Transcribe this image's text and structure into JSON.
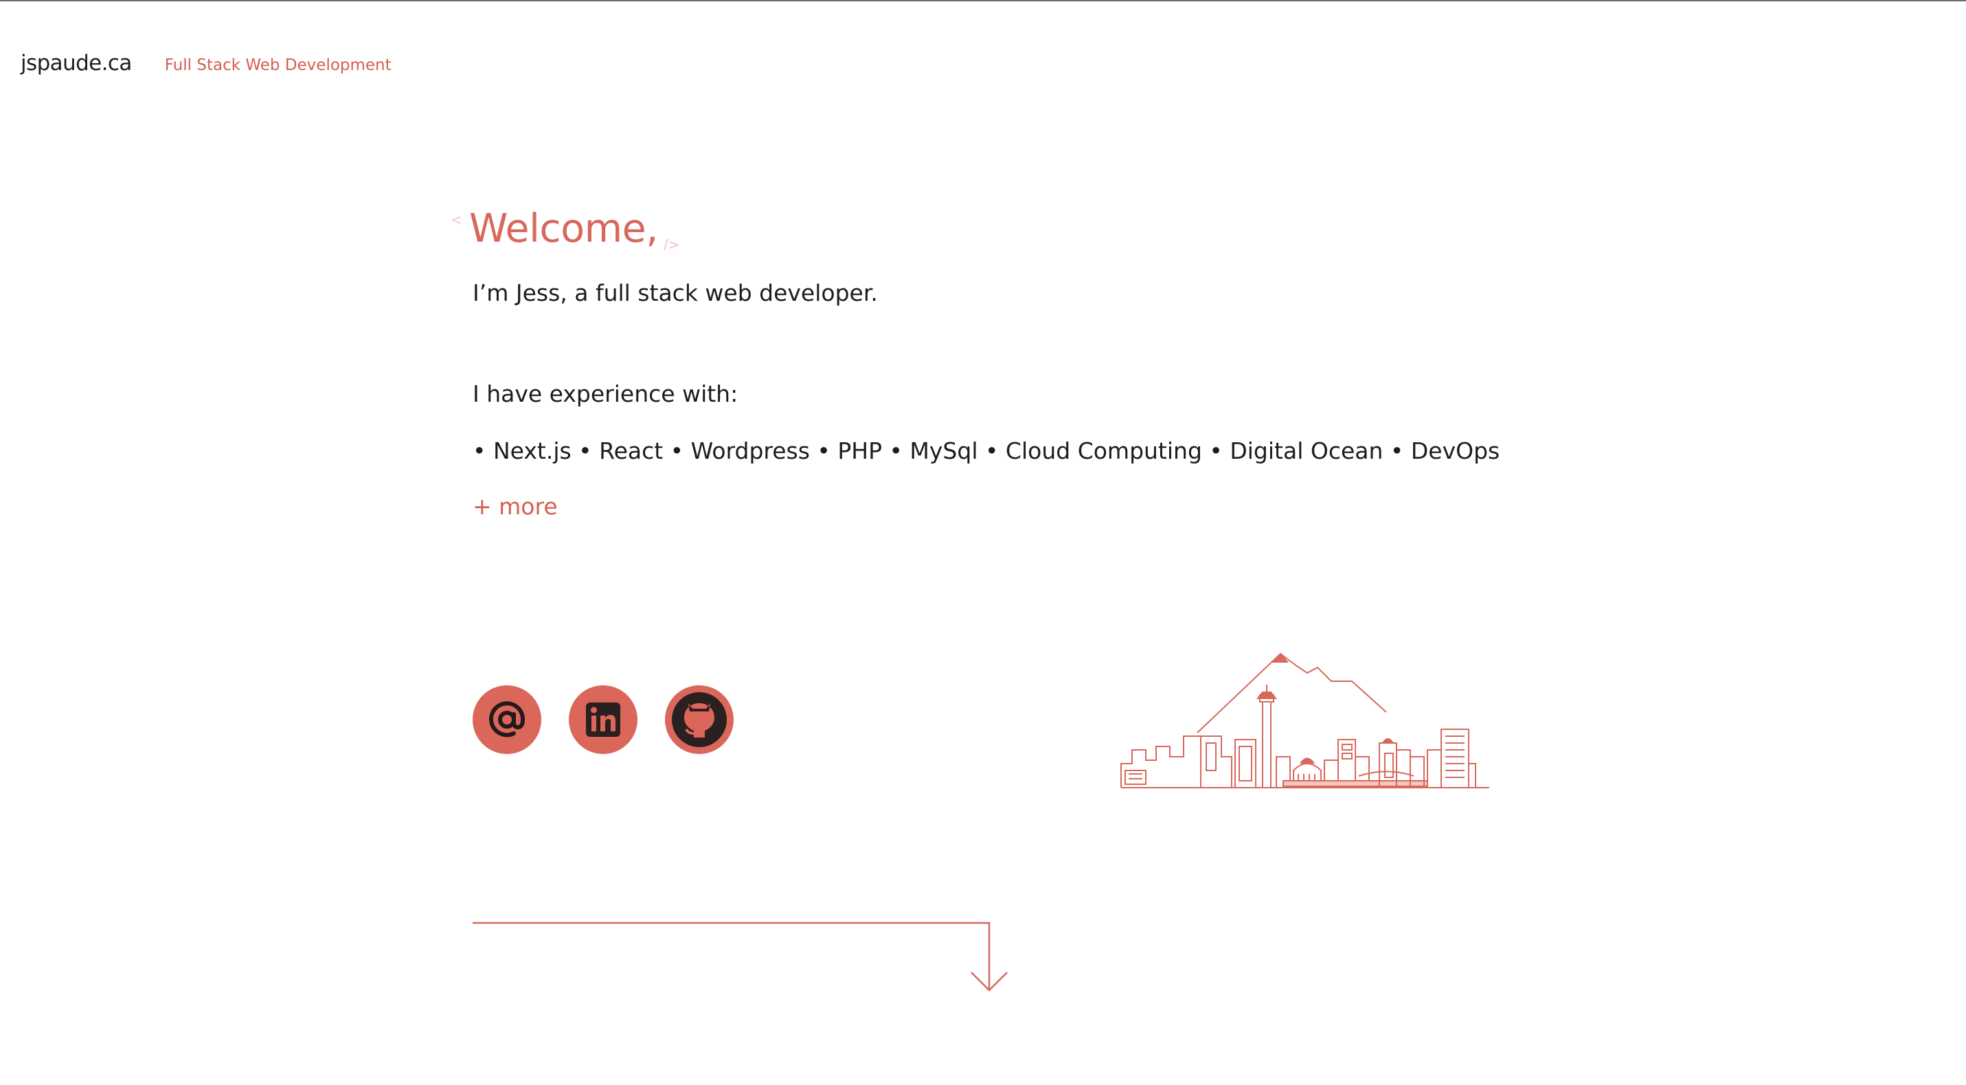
{
  "header": {
    "logo": "jspaude.ca",
    "tagline": "Full Stack Web Development"
  },
  "hero": {
    "tag_open": "<",
    "title": "Welcome,",
    "tag_close": "/>",
    "intro": "I’m Jess, a full stack web developer.",
    "experience_label": "I have experience with:",
    "skills": "• Next.js • React • Wordpress • PHP • MySql • Cloud Computing • Digital Ocean • DevOps",
    "more_link": "+ more"
  },
  "socials": [
    {
      "icon": "email-at-icon"
    },
    {
      "icon": "linkedin-icon"
    },
    {
      "icon": "github-icon"
    }
  ],
  "colors": {
    "accent": "#db665a",
    "text": "#1c1c1c",
    "icon_dark": "#2a2020"
  }
}
